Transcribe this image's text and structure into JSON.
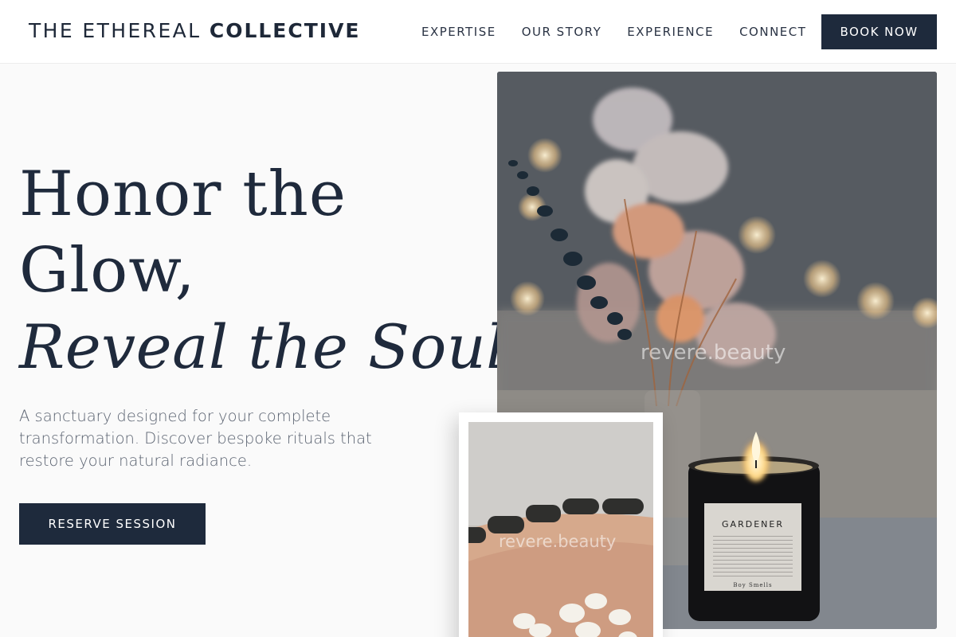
{
  "header": {
    "logo_light": "THE ETHEREAL",
    "logo_bold": "COLLECTIVE",
    "nav": [
      {
        "label": "EXPERTISE"
      },
      {
        "label": "OUR STORY"
      },
      {
        "label": "EXPERIENCE"
      },
      {
        "label": "CONNECT"
      }
    ],
    "book_label": "BOOK NOW"
  },
  "hero": {
    "title_line1": "Honor the",
    "title_line2": "Glow,",
    "title_line3": "Reveal the Soul.",
    "subtitle": "A sanctuary designed for your complete transformation. Discover bespoke rituals that restore your natural radiance.",
    "cta_label": "RESERVE SESSION"
  },
  "images": {
    "main_watermark": "revere.beauty",
    "inset_watermark": "revere.beauty",
    "candle_name": "GARDENER",
    "candle_brand": "Boy Smells"
  },
  "colors": {
    "navy": "#1e2a3c",
    "text": "#1f2a3c",
    "subtext": "#5a6270",
    "background": "#fafafa"
  }
}
